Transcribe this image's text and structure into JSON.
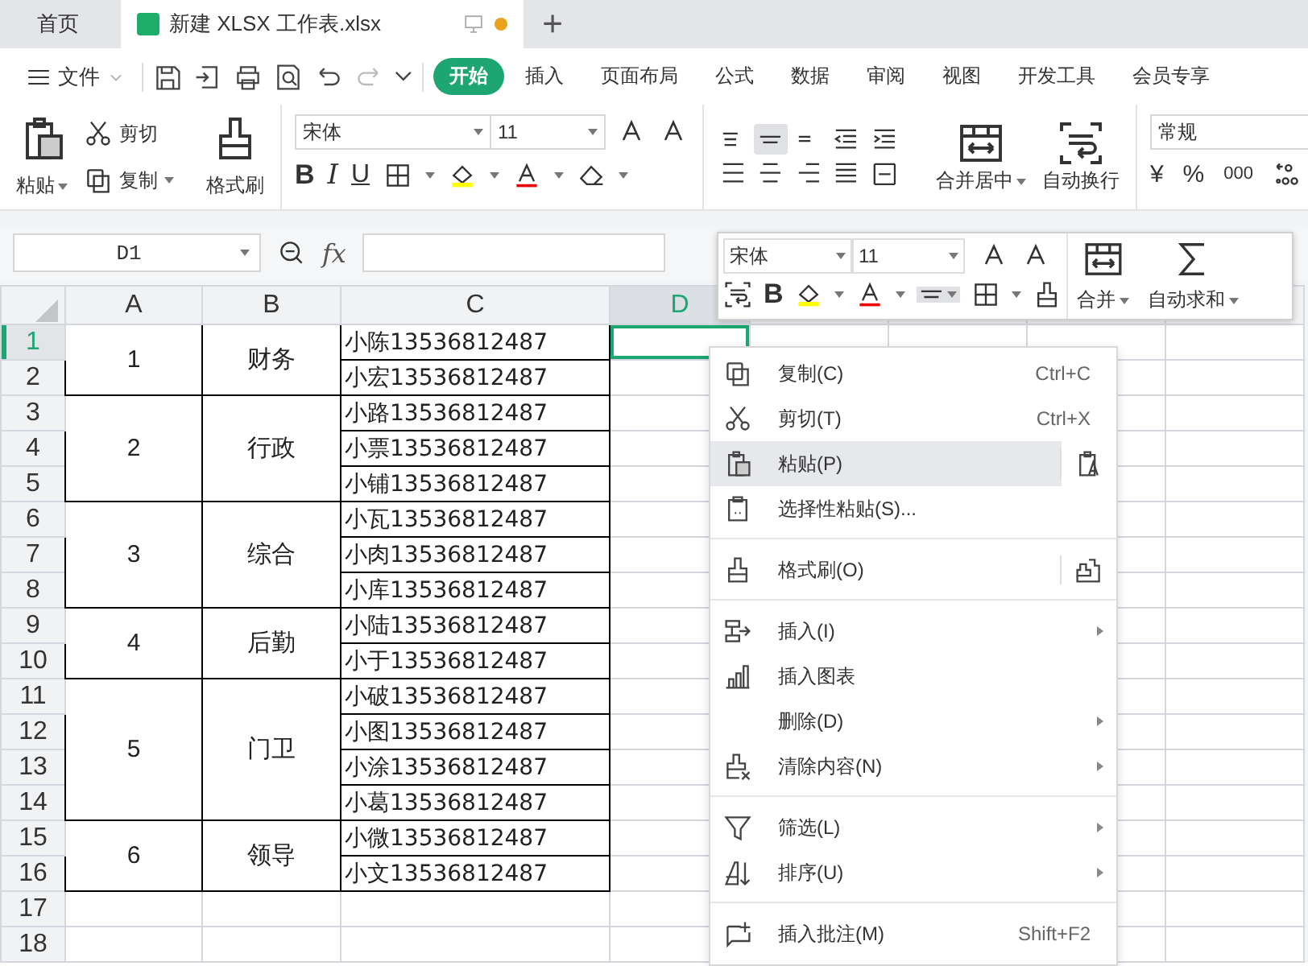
{
  "tabs": [
    {
      "label": "首页",
      "selected": false
    },
    {
      "label": "新建 XLSX 工作表.xlsx",
      "selected": true
    }
  ],
  "new_tab": "+",
  "file_menu": "文件",
  "ribbon_tabs": [
    {
      "label": "开始",
      "selected": true
    },
    {
      "label": "插入",
      "selected": false
    },
    {
      "label": "页面布局",
      "selected": false
    },
    {
      "label": "公式",
      "selected": false
    },
    {
      "label": "数据",
      "selected": false
    },
    {
      "label": "审阅",
      "selected": false
    },
    {
      "label": "视图",
      "selected": false
    },
    {
      "label": "开发工具",
      "selected": false
    },
    {
      "label": "会员专享",
      "selected": false
    }
  ],
  "ribbon": {
    "paste": "粘贴",
    "cut": "剪切",
    "copy": "复制",
    "format_painter": "格式刷",
    "font": "宋体",
    "font_size": "11",
    "align_buttons": [
      {
        "selected": false
      },
      {
        "selected": true
      },
      {
        "selected": false
      },
      {
        "selected": false
      },
      {
        "selected": false
      },
      {
        "selected": false
      },
      {
        "selected": false
      },
      {
        "selected": false
      },
      {
        "selected": false
      },
      {
        "selected": false
      }
    ],
    "bold": "B",
    "italic": "I",
    "underline": "U",
    "merge": "合并居中",
    "wrap": "自动换行",
    "number_format": "常规",
    "currency": "¥",
    "percent": "%",
    "thousands": "000"
  },
  "name_box": "D1",
  "fx": "fx",
  "sheet": {
    "columns": [
      {
        "label": "A",
        "selected": false
      },
      {
        "label": "B",
        "selected": false
      },
      {
        "label": "C",
        "selected": false
      },
      {
        "label": "D",
        "selected": true
      }
    ],
    "rows": [
      {
        "label": "1",
        "selected": true
      },
      {
        "label": "2",
        "selected": false
      },
      {
        "label": "3",
        "selected": false
      },
      {
        "label": "4",
        "selected": false
      },
      {
        "label": "5",
        "selected": false
      },
      {
        "label": "6",
        "selected": false
      },
      {
        "label": "7",
        "selected": false
      },
      {
        "label": "8",
        "selected": false
      },
      {
        "label": "9",
        "selected": false
      },
      {
        "label": "10",
        "selected": false
      },
      {
        "label": "11",
        "selected": false
      },
      {
        "label": "12",
        "selected": false
      },
      {
        "label": "13",
        "selected": false
      },
      {
        "label": "14",
        "selected": false
      },
      {
        "label": "15",
        "selected": false
      },
      {
        "label": "16",
        "selected": false
      },
      {
        "label": "17",
        "selected": false
      },
      {
        "label": "18",
        "selected": false
      }
    ],
    "groups": [
      {
        "number": "1",
        "department": "财务",
        "contacts": [
          "小陈13536812487",
          "小宏13536812487"
        ]
      },
      {
        "number": "2",
        "department": "行政",
        "contacts": [
          "小路13536812487",
          "小票13536812487",
          "小铺13536812487"
        ]
      },
      {
        "number": "3",
        "department": "综合",
        "contacts": [
          "小瓦13536812487",
          "小肉13536812487",
          "小库13536812487"
        ]
      },
      {
        "number": "4",
        "department": "后勤",
        "contacts": [
          "小陆13536812487",
          "小于13536812487"
        ]
      },
      {
        "number": "5",
        "department": "门卫",
        "contacts": [
          "小破13536812487",
          "小图13536812487",
          "小涂13536812487",
          "小葛13536812487"
        ]
      },
      {
        "number": "6",
        "department": "领导",
        "contacts": [
          "小微13536812487",
          "小文13536812487"
        ]
      }
    ]
  },
  "mini_toolbar": {
    "font": "宋体",
    "font_size": "11",
    "bold": "B",
    "merge": "合并",
    "autosum": "自动求和",
    "align_selected": true
  },
  "context_menu": {
    "items": [
      {
        "kind": "item",
        "label": "复制(C)",
        "shortcut": "Ctrl+C",
        "submenu": false,
        "selected": false
      },
      {
        "kind": "item",
        "label": "剪切(T)",
        "shortcut": "Ctrl+X",
        "submenu": false,
        "selected": false
      },
      {
        "kind": "item",
        "label": "粘贴(P)",
        "submenu": false,
        "selected": true
      },
      {
        "kind": "item",
        "label": "选择性粘贴(S)...",
        "submenu": false,
        "selected": false
      },
      {
        "kind": "separator"
      },
      {
        "kind": "item",
        "label": "格式刷(O)",
        "submenu": false,
        "selected": false
      },
      {
        "kind": "separator"
      },
      {
        "kind": "item",
        "label": "插入(I)",
        "submenu": true,
        "selected": false
      },
      {
        "kind": "item",
        "label": "插入图表",
        "submenu": false,
        "selected": false
      },
      {
        "kind": "item",
        "label": "删除(D)",
        "submenu": true,
        "selected": false
      },
      {
        "kind": "item",
        "label": "清除内容(N)",
        "submenu": true,
        "selected": false
      },
      {
        "kind": "separator"
      },
      {
        "kind": "item",
        "label": "筛选(L)",
        "submenu": true,
        "selected": false
      },
      {
        "kind": "item",
        "label": "排序(U)",
        "submenu": true,
        "selected": false
      },
      {
        "kind": "separator"
      },
      {
        "kind": "item",
        "label": "插入批注(M)",
        "shortcut": "Shift+F2",
        "submenu": false,
        "selected": false
      }
    ]
  }
}
